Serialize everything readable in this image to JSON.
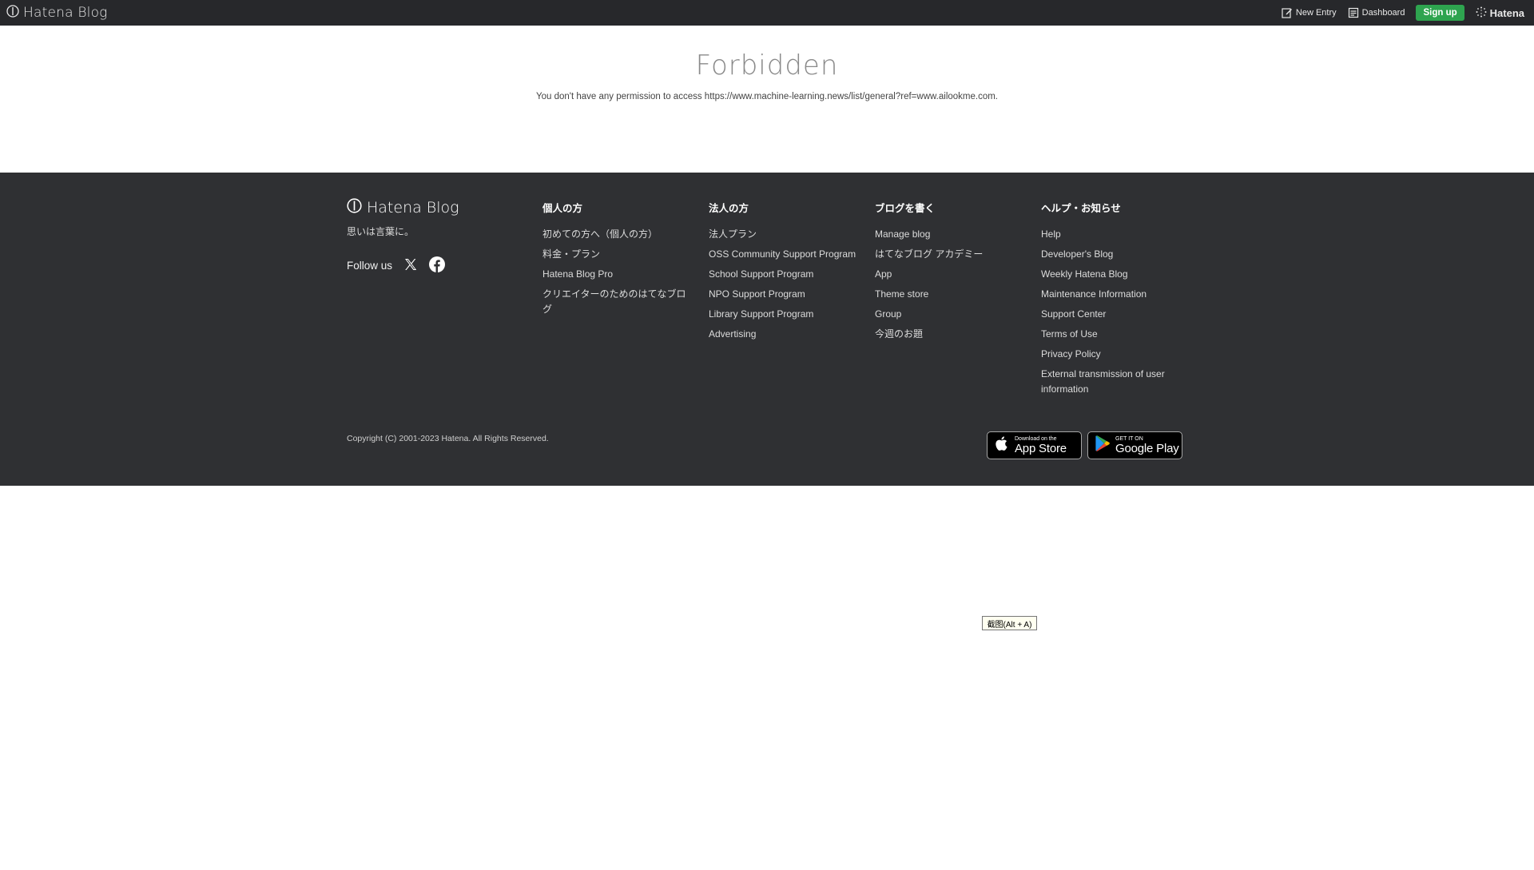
{
  "topbar": {
    "logo_text": "Hatena Blog",
    "new_entry": "New Entry",
    "dashboard": "Dashboard",
    "signup": "Sign up",
    "hatena": "Hatena"
  },
  "main": {
    "title": "Forbidden",
    "message": "You don't have any permission to access https://www.machine-learning.news/list/general?ref=www.ailookme.com."
  },
  "footer": {
    "logo_text": "Hatena Blog",
    "tagline": "思いは言葉に。",
    "follow_label": "Follow us",
    "columns": [
      {
        "title": "個人の方",
        "items": [
          "初めての方へ（個人の方）",
          "料金・プラン",
          "Hatena Blog Pro",
          "クリエイターのためのはてなブログ"
        ]
      },
      {
        "title": "法人の方",
        "items": [
          "法人プラン",
          "OSS Community Support Program",
          "School Support Program",
          "NPO Support Program",
          "Library Support Program",
          "Advertising"
        ]
      },
      {
        "title": "ブログを書く",
        "items": [
          "Manage blog",
          "はてなブログ アカデミー",
          "App",
          "Theme store",
          "Group",
          "今週のお題"
        ]
      },
      {
        "title": "ヘルプ・お知らせ",
        "items": [
          "Help",
          "Developer's Blog",
          "Weekly Hatena Blog",
          "Maintenance Information",
          "Support Center",
          "Terms of Use",
          "Privacy Policy",
          "External transmission of user information"
        ]
      }
    ],
    "copyright": "Copyright (C) 2001-2023 Hatena. All Rights Reserved.",
    "app_store": {
      "small": "Download on the",
      "big": "App Store"
    },
    "google_play": {
      "small": "GET IT ON",
      "big": "Google Play"
    }
  },
  "tooltip": "截图(Alt + A)",
  "colors": {
    "topbar_bg": "#27282b",
    "footer_bg": "#2f3033",
    "signup_green": "#2ea44f"
  }
}
